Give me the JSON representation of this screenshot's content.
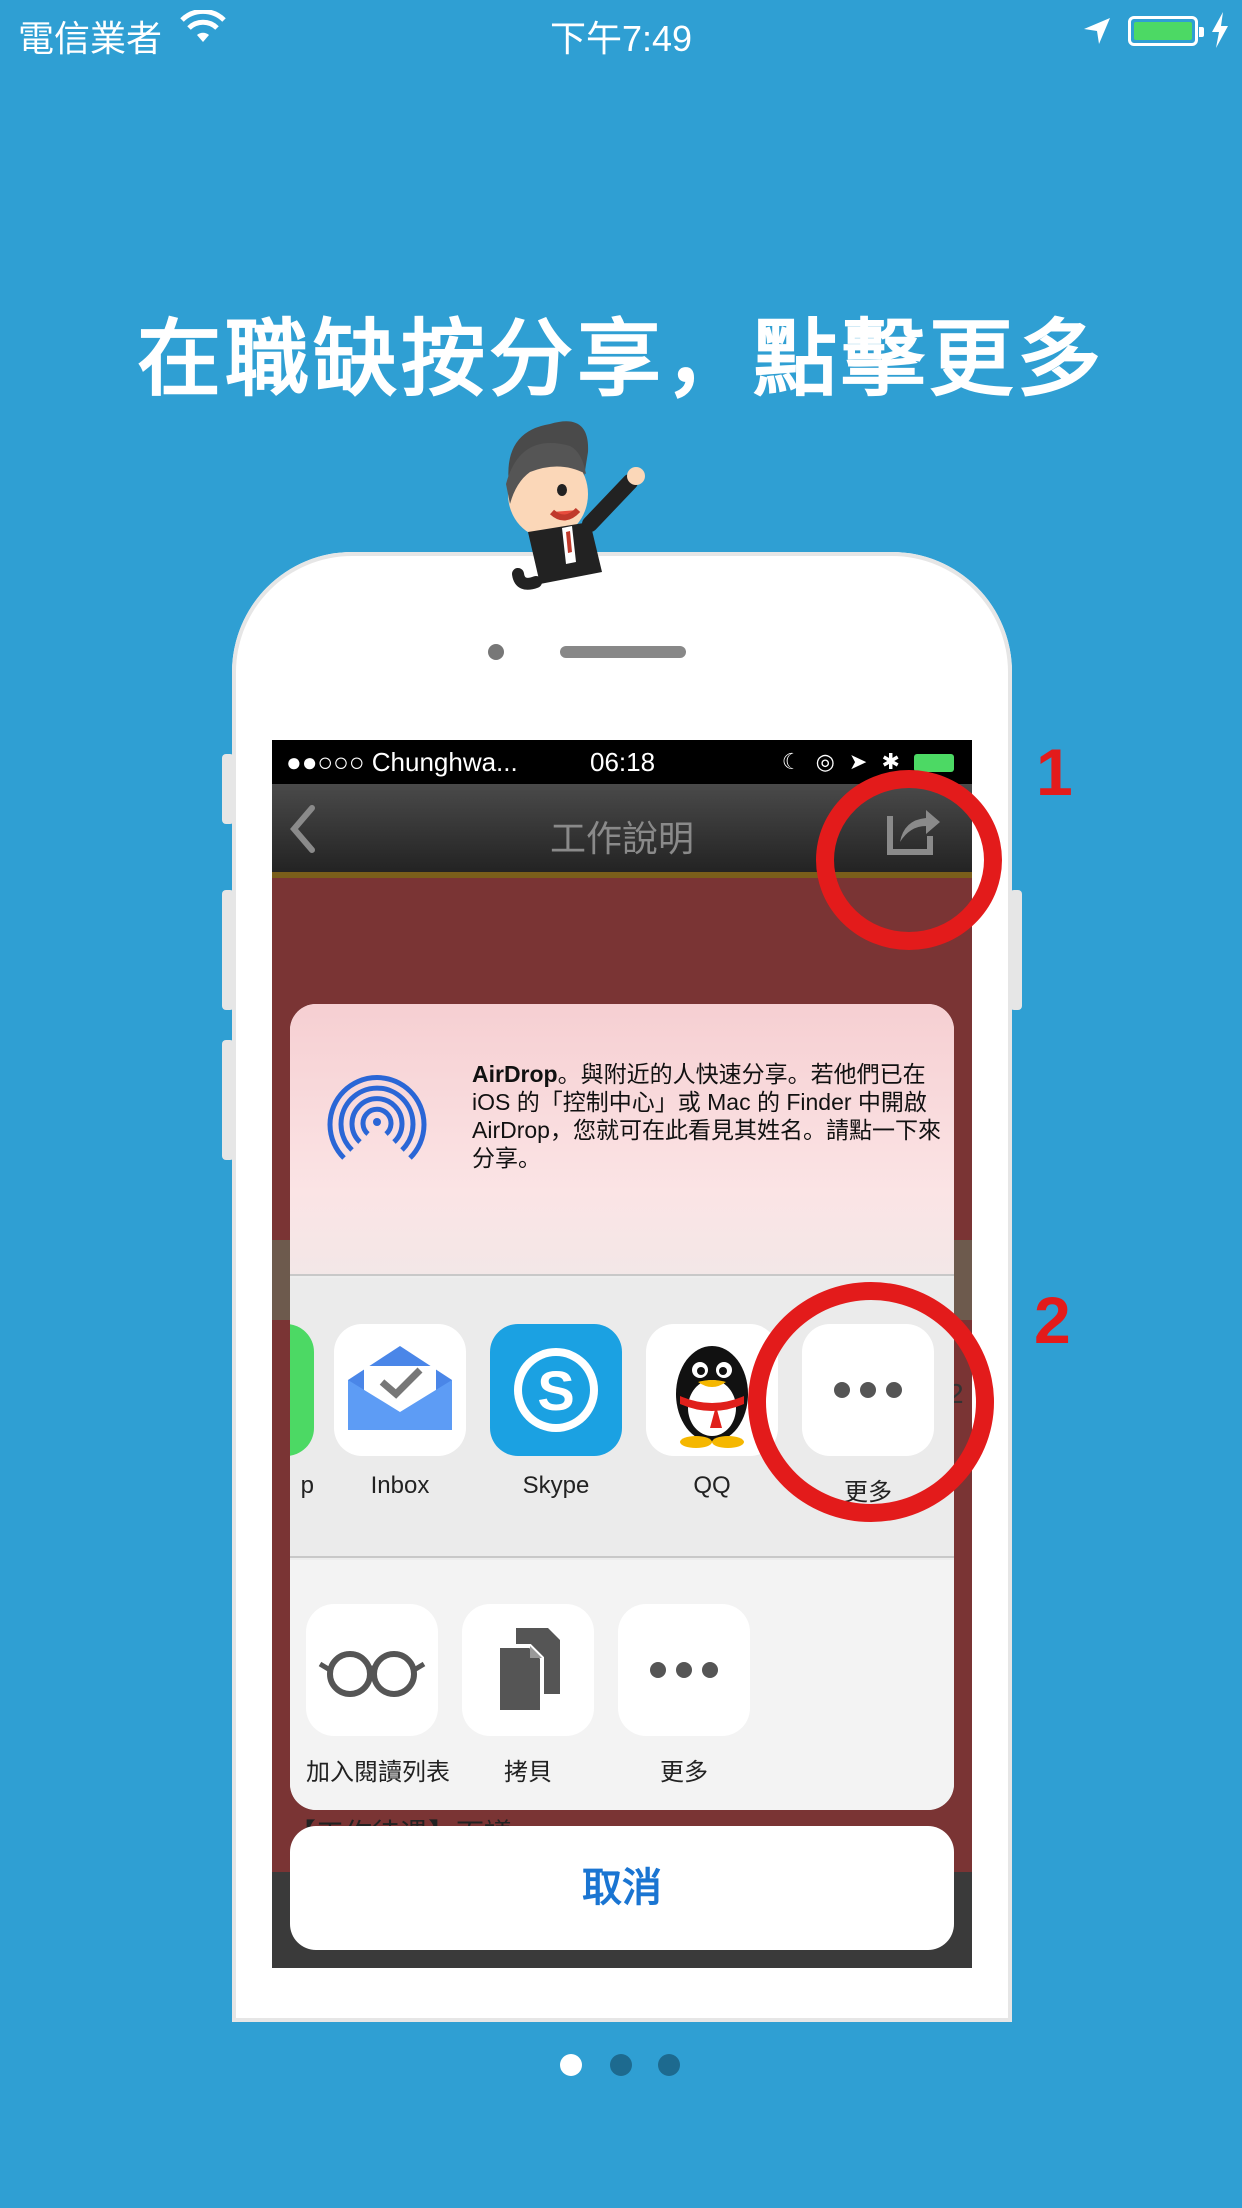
{
  "status_bar": {
    "carrier": "電信業者",
    "time": "下午7:49"
  },
  "headline": "在職缺按分享，點擊更多",
  "inner_screen": {
    "status": {
      "carrier": "●●○○○ Chunghwa...",
      "time": "06:18"
    },
    "nav_title": "工作說明",
    "peek_text": "【工作待遇】面議",
    "side_number": "2"
  },
  "share_sheet": {
    "airdrop": {
      "title": "AirDrop",
      "description": "。與附近的人快速分享。若他們已在 iOS 的「控制中心」或 Mac 的 Finder 中開啟 AirDrop，您就可在此看見其姓名。請點一下來分享。"
    },
    "apps": [
      {
        "label": "p",
        "icon": "messages-icon"
      },
      {
        "label": "Inbox",
        "icon": "inbox-icon"
      },
      {
        "label": "Skype",
        "icon": "skype-icon"
      },
      {
        "label": "QQ",
        "icon": "qq-icon"
      },
      {
        "label": "更多",
        "icon": "more-icon"
      }
    ],
    "actions": [
      {
        "label": "加入閱讀列表",
        "icon": "glasses-icon"
      },
      {
        "label": "拷貝",
        "icon": "copy-icon"
      },
      {
        "label": "更多",
        "icon": "more-icon"
      }
    ],
    "cancel_label": "取消"
  },
  "annotations": {
    "step1": "1",
    "step2": "2"
  },
  "pager": {
    "total": 3,
    "active": 1
  },
  "colors": {
    "background": "#2f9fd3",
    "annotation_red": "#e31b1b",
    "cancel_blue": "#1a75d2"
  }
}
